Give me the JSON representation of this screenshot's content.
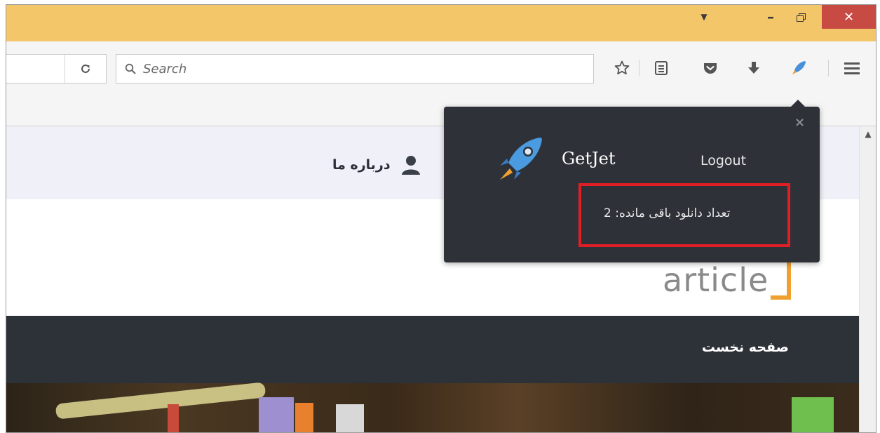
{
  "titlebar": {
    "tabs_icon": "tab-list-arrow-icon",
    "minimize_icon": "minimize-icon",
    "restore_icon": "restore-icon",
    "close_glyph": "✕"
  },
  "toolbar": {
    "reload_glyph": "C",
    "search_placeholder": "Search",
    "icons": [
      "star-icon",
      "reading-list-icon",
      "pocket-icon",
      "download-icon",
      "getjet-rocket-icon",
      "menu-icon"
    ]
  },
  "page": {
    "nav_about": "درباره ما",
    "logo_text": "article",
    "home_link": "صفحه نخست"
  },
  "popup": {
    "close_glyph": "×",
    "brand": "GetJet",
    "logout": "Logout",
    "remaining_downloads": "تعداد دانلود باقی مانده: 2",
    "highlight_color": "#e01e25"
  },
  "colors": {
    "titlebar": "#f4c66a",
    "close_button": "#c74a43",
    "popup_bg": "#2e3238",
    "page_dark_bar": "#2d3138",
    "page_nav_bg": "#f0f1f8",
    "logo_accent": "#f0a030"
  }
}
